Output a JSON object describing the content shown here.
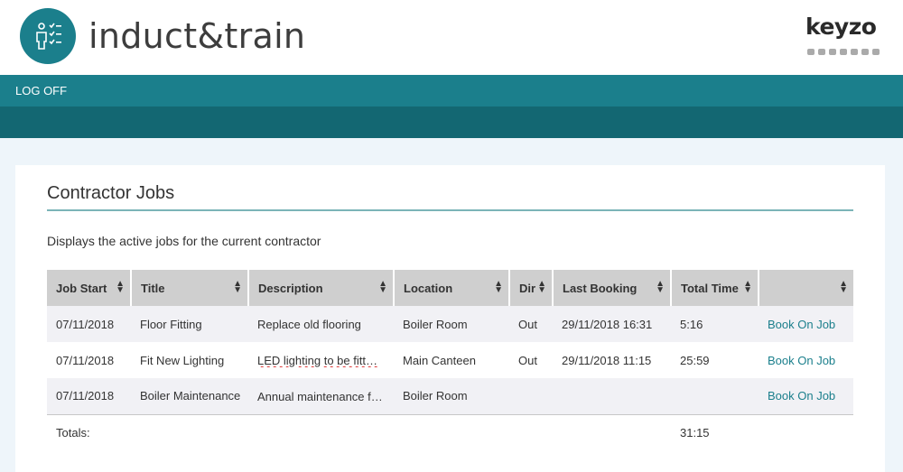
{
  "header": {
    "brand": "induct&train",
    "partner_logo": "keyzo",
    "logo_icon": "person-checklist-icon"
  },
  "nav": {
    "logoff_label": "LOG OFF"
  },
  "panel": {
    "title": "Contractor Jobs",
    "description": "Displays the active jobs for the current contractor"
  },
  "table": {
    "columns": [
      "Job Start",
      "Title",
      "Description",
      "Location",
      "Dir",
      "Last Booking",
      "Total Time",
      ""
    ],
    "rows": [
      {
        "job_start": "07/11/2018",
        "title": "Floor Fitting",
        "description": "Replace old flooring",
        "location": "Boiler Room",
        "dir": "Out",
        "last_booking": "29/11/2018 16:31",
        "total_time": "5:16",
        "action": "Book On Job"
      },
      {
        "job_start": "07/11/2018",
        "title": "Fit New Lighting",
        "description": "LED lighting to be fitt…",
        "location": "Main Canteen",
        "dir": "Out",
        "last_booking": "29/11/2018 11:15",
        "total_time": "25:59",
        "action": "Book On Job"
      },
      {
        "job_start": "07/11/2018",
        "title": "Boiler Maintenance",
        "description": "Annual maintenance f…",
        "location": "Boiler Room",
        "dir": "",
        "last_booking": "",
        "total_time": "",
        "action": "Book On Job"
      }
    ],
    "totals_label": "Totals:",
    "totals_time": "31:15"
  },
  "colors": {
    "brand_teal": "#1b7f8c",
    "dark_teal": "#136772",
    "header_bg": "#cfcfcf"
  }
}
